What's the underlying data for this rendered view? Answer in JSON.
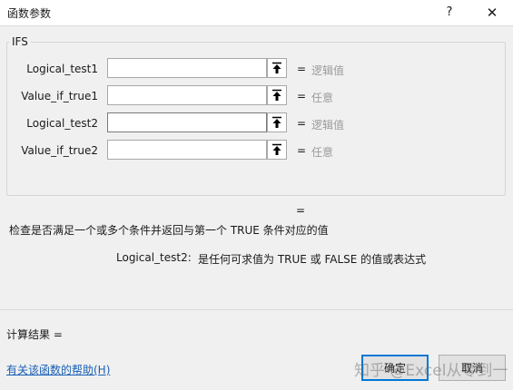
{
  "window": {
    "title": "函数参数",
    "help_label": "?",
    "close_label": "✕"
  },
  "function_name": "IFS",
  "arguments": [
    {
      "label": "Logical_test1",
      "value": "",
      "equals": "=",
      "hint": "逻辑值"
    },
    {
      "label": "Value_if_true1",
      "value": "",
      "equals": "=",
      "hint": "任意"
    },
    {
      "label": "Logical_test2",
      "value": "",
      "equals": "=",
      "hint": "逻辑值"
    },
    {
      "label": "Value_if_true2",
      "value": "",
      "equals": "=",
      "hint": "任意"
    }
  ],
  "formula_result_equals": "=",
  "description": "检查是否满足一个或多个条件并返回与第一个 TRUE 条件对应的值",
  "argument_help": {
    "name": "Logical_test2:",
    "text": "是任何可求值为 TRUE 或 FALSE 的值或表达式"
  },
  "result_label": "计算结果 =",
  "help_link": "有关该函数的帮助(H)",
  "buttons": {
    "ok": "确定",
    "cancel": "取消"
  },
  "watermark": "知乎 @Excel从零到一",
  "icons": {
    "collapse": "collapse-dialog-arrow-icon"
  },
  "colors": {
    "background": "#f0f0f0",
    "link": "#1a5fb4",
    "hint": "#9a9a9a",
    "primary_border": "#0078d7"
  }
}
